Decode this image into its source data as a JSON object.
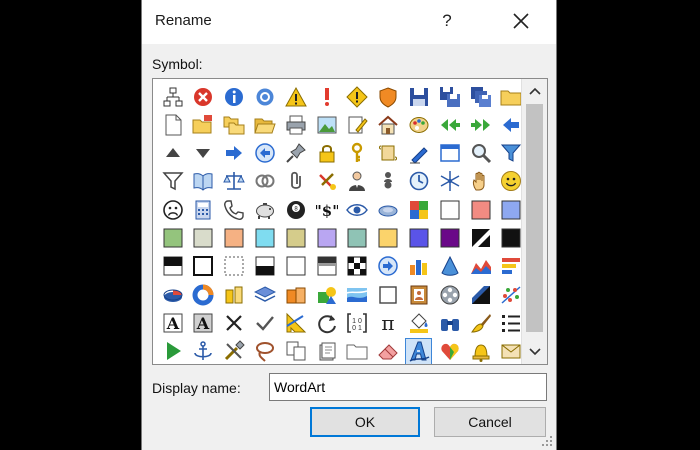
{
  "dialog": {
    "title": "Rename",
    "help_label": "?",
    "close_icon": "close-icon",
    "help_icon": "help-question-icon"
  },
  "symbols": {
    "label": "Symbol:",
    "selected": "wordart-icon",
    "rows": [
      [
        "org-chart-icon",
        "error-x-icon",
        "info-icon",
        "ring-icon",
        "warning-icon",
        "exclamation-icon",
        "warning-diamond-icon",
        "shield-icon",
        "save-disk-icon",
        "save-copy-icon",
        "save-all-icon",
        "folder-icon"
      ],
      [
        "new-page-icon",
        "open-folder-icon",
        "folders-icon",
        "folder-open-icon",
        "printer-icon",
        "picture-icon",
        "edit-note-icon",
        "home-icon",
        "palette-icon",
        "back-arrows-icon",
        "forward-arrows-icon",
        "left-arrow-icon"
      ],
      [
        "triangle-up-icon",
        "triangle-down-icon",
        "arrow-right-icon",
        "circle-left-arrow-icon",
        "pushpin-icon",
        "padlock-icon",
        "key-icon",
        "scroll-icon",
        "pen-icon",
        "window-icon",
        "magnifier-icon",
        "funnel-icon"
      ],
      [
        "funnel-outline-icon",
        "book-icon",
        "balance-scale-icon",
        "rings-icon",
        "paperclip-icon",
        "no-tools-icon",
        "person-icon",
        "person-pair-icon",
        "clock-icon",
        "snowflake-icon",
        "hand-icon",
        "smiley-icon"
      ],
      [
        "frown-icon",
        "calculator-icon",
        "telephone-icon",
        "piggy-bank-icon",
        "eight-ball-icon",
        "quote-dollar-icon",
        "eye-icon",
        "disc-icon",
        "color-squares-icon",
        "white-swatch-icon",
        "salmon-swatch-icon",
        "periwinkle-swatch-icon"
      ],
      [
        "green-swatch-icon",
        "beige-swatch-icon",
        "orange-swatch-icon",
        "cyan-swatch-icon",
        "olive-swatch-icon",
        "lavender-swatch-icon",
        "teal-swatch-icon",
        "yellow-swatch-icon",
        "blue-swatch-icon",
        "purple-swatch-icon",
        "diagonal-swatch-icon",
        "black-swatch-icon"
      ],
      [
        "black-top-swatch-icon",
        "white-bordered-swatch-icon",
        "dotted-swatch-icon",
        "half-black-swatch-icon",
        "white-plain-swatch-icon",
        "gray-top-swatch-icon",
        "checkerboard-icon",
        "circle-arrow-right-icon",
        "bar-chart-icon",
        "cone-icon",
        "area-chart-icon",
        "stacked-bars-icon"
      ],
      [
        "pie-chart-icon",
        "donut-chart-icon",
        "cylinders-icon",
        "layers-icon",
        "boxes-icon",
        "shapes-icon",
        "landscape-icon",
        "frame-icon",
        "picture-frame-icon",
        "film-reel-icon",
        "gradient-icon",
        "scatter-icon"
      ],
      [
        "text-a-icon",
        "shaded-text-a-icon",
        "x-mark-icon",
        "checkmark-icon",
        "angle-ruler-icon",
        "refresh-icon",
        "brackets-icon",
        "pi-icon",
        "paint-bucket-icon",
        "binoculars-icon",
        "brush-icon",
        "list-icon"
      ],
      [
        "play-icon",
        "anchor-icon",
        "tools-icon",
        "lasso-icon",
        "copy-pages-icon",
        "document-stack-icon",
        "folder-plain-icon",
        "eraser-icon",
        "wordart-icon",
        "heart-shape-icon",
        "bell-icon",
        "envelope-icon"
      ]
    ]
  },
  "swatch_colors": {
    "green": "#94c47d",
    "beige": "#d9dccb",
    "orange": "#f5b183",
    "cyan": "#7fdcf0",
    "olive": "#d5cc8b",
    "lavender": "#b9a6f2",
    "teal": "#8fc3b5",
    "yellow": "#fbd36b",
    "blue": "#5a54e8",
    "purple": "#6a0888",
    "salmon": "#f28b82",
    "periwinkle": "#8ea8f0"
  },
  "display_name": {
    "label": "Display name:",
    "value": "WordArt"
  },
  "buttons": {
    "ok": "OK",
    "cancel": "Cancel"
  },
  "accent_color": "#0078d7"
}
